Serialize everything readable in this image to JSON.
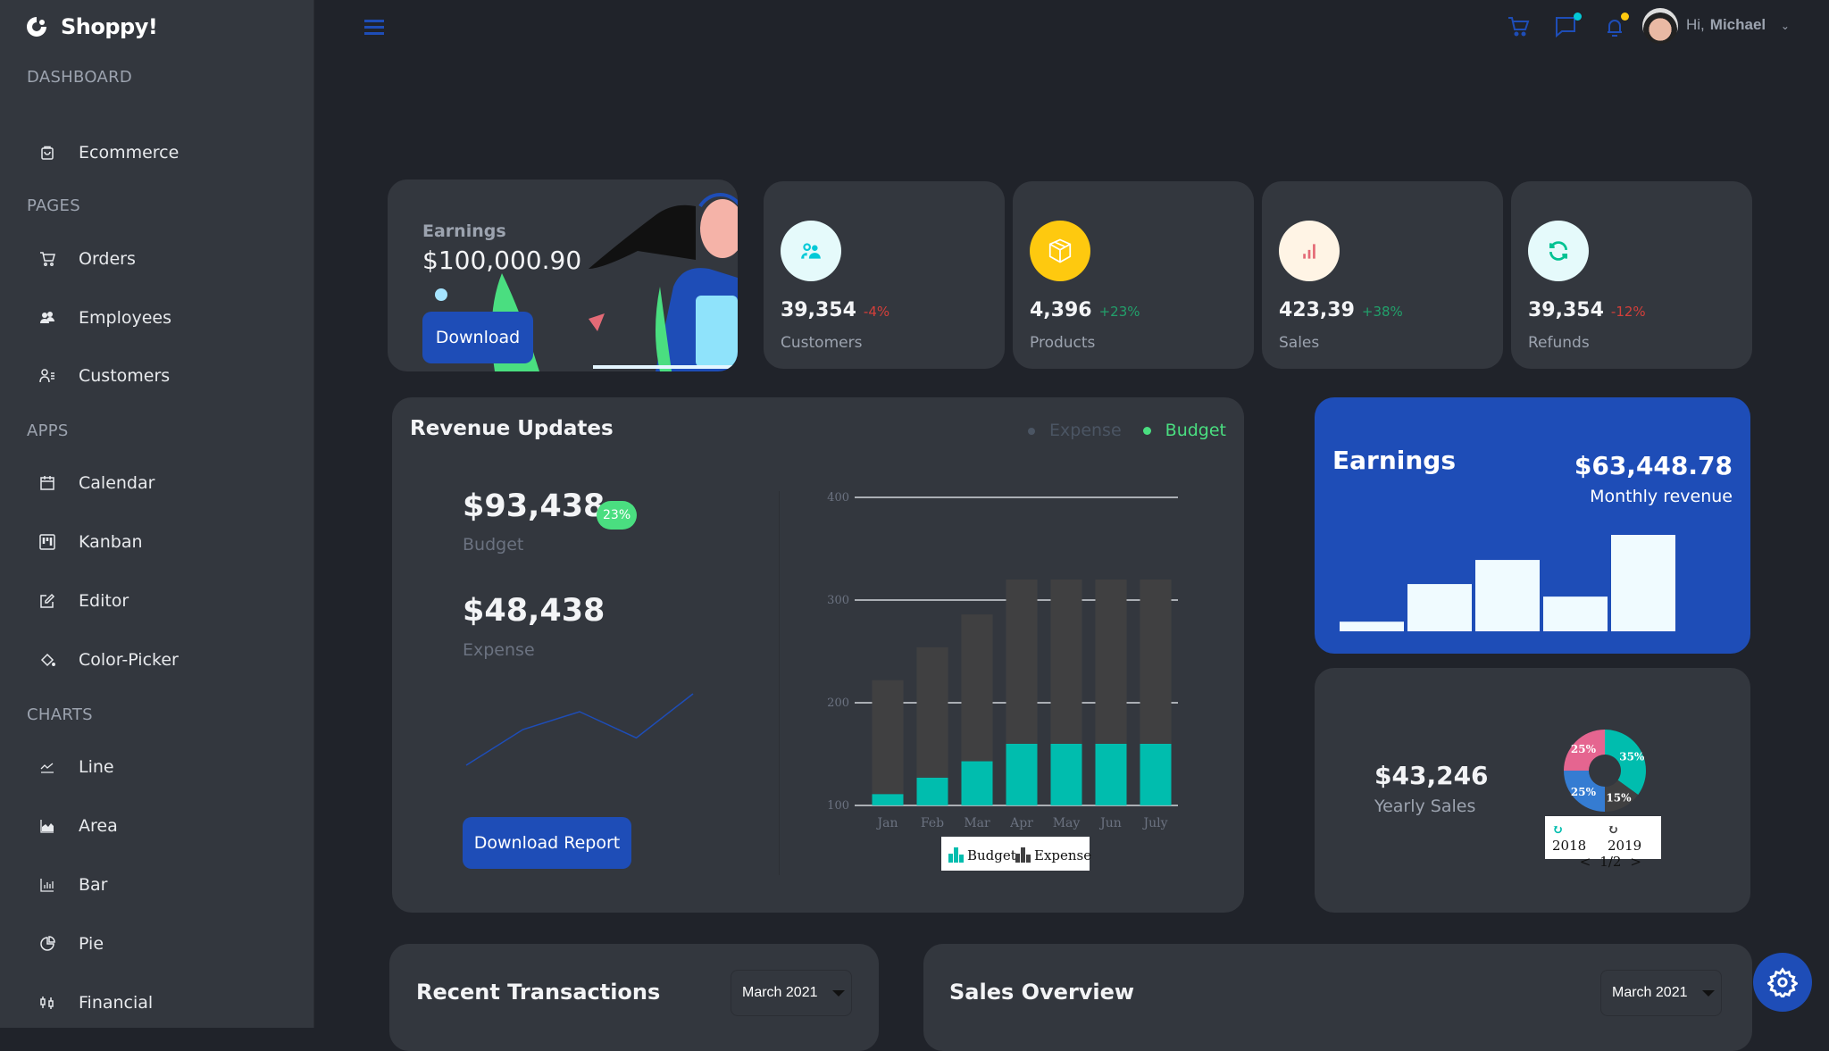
{
  "app": {
    "name": "Shoppy!"
  },
  "sidebar": {
    "sections": [
      {
        "title": "DASHBOARD",
        "items": [
          {
            "label": "Ecommerce",
            "icon": "shopping-bag-icon"
          }
        ]
      },
      {
        "title": "PAGES",
        "items": [
          {
            "label": "Orders",
            "icon": "cart-icon"
          },
          {
            "label": "Employees",
            "icon": "employees-icon"
          },
          {
            "label": "Customers",
            "icon": "customers-icon"
          }
        ]
      },
      {
        "title": "APPS",
        "items": [
          {
            "label": "Calendar",
            "icon": "calendar-icon"
          },
          {
            "label": "Kanban",
            "icon": "kanban-icon"
          },
          {
            "label": "Editor",
            "icon": "edit-icon"
          },
          {
            "label": "Color-Picker",
            "icon": "paint-bucket-icon"
          }
        ]
      },
      {
        "title": "CHARTS",
        "items": [
          {
            "label": "Line",
            "icon": "line-chart-icon"
          },
          {
            "label": "Area",
            "icon": "area-chart-icon"
          },
          {
            "label": "Bar",
            "icon": "bar-chart-icon"
          },
          {
            "label": "Pie",
            "icon": "pie-chart-icon"
          },
          {
            "label": "Financial",
            "icon": "candlestick-icon"
          }
        ]
      }
    ]
  },
  "header": {
    "greeting": "Hi,",
    "user_name": "Michael",
    "icons": [
      "menu-icon",
      "cart-icon",
      "chat-icon",
      "bell-icon",
      "avatar",
      "chevron-down-icon"
    ],
    "notification_colors": {
      "chat": "#03C9D7",
      "bell": "#FEC90F"
    }
  },
  "earnings_banner": {
    "title": "Earnings",
    "amount": "$100,000.90",
    "button": "Download"
  },
  "stats": [
    {
      "value": "39,354",
      "change": "-4%",
      "trend": "down",
      "label": "Customers",
      "icon": "customers-icon",
      "icon_color": "#03C9D7",
      "bg": "#E5FAFB"
    },
    {
      "value": "4,396",
      "change": "+23%",
      "trend": "up",
      "label": "Products",
      "icon": "box-icon",
      "icon_color": "#FFFFFF",
      "bg": "#FEC90F"
    },
    {
      "value": "423,39",
      "change": "+38%",
      "trend": "up",
      "label": "Sales",
      "icon": "bar-chart-icon",
      "icon_color": "#E46A76",
      "bg": "#FFF4E5"
    },
    {
      "value": "39,354",
      "change": "-12%",
      "trend": "down",
      "label": "Refunds",
      "icon": "refresh-icon",
      "icon_color": "#00C292",
      "bg": "#E5FAFB"
    }
  ],
  "revenue": {
    "title": "Revenue Updates",
    "legend": [
      {
        "label": "Expense",
        "color": "#4b5563"
      },
      {
        "label": "Budget",
        "color": "#4ade80"
      }
    ],
    "budget_value": "$93,438",
    "budget_badge": "23%",
    "budget_label": "Budget",
    "expense_value": "$48,438",
    "expense_label": "Expense",
    "button": "Download Report",
    "sparkline": [
      1,
      4,
      5.5,
      3.3,
      7
    ]
  },
  "earnings_card": {
    "title": "Earnings",
    "amount": "$63,448.78",
    "subtitle": "Monthly revenue",
    "bars": [
      10,
      49,
      74,
      36,
      100
    ]
  },
  "yearly": {
    "amount": "$43,246",
    "label": "Yearly Sales",
    "legend": [
      "2018",
      "2019"
    ],
    "pager": "1/2",
    "prev": "<",
    "next": ">"
  },
  "bottom": {
    "transactions_title": "Recent Transactions",
    "transactions_period": "March 2021",
    "sales_title": "Sales Overview",
    "sales_period": "March 2021"
  },
  "colors": {
    "accent": "#1E4DB7",
    "budget": "#00BDAE",
    "expense": "#404041",
    "up": "#22A06B",
    "down": "#D43F3A"
  },
  "chart_data": [
    {
      "type": "bar",
      "title": "Revenue Updates",
      "stacked": true,
      "categories": [
        "Jan",
        "Feb",
        "Mar",
        "Apr",
        "May",
        "Jun",
        "July"
      ],
      "series": [
        {
          "name": "Budget",
          "values": [
            111,
            127,
            143,
            160,
            160,
            160,
            160
          ]
        },
        {
          "name": "Expense",
          "values": [
            111,
            127,
            143,
            160,
            160,
            160,
            160
          ]
        }
      ],
      "ylim": [
        100,
        400
      ],
      "yticks": [
        100,
        200,
        300,
        400
      ],
      "legend": "bottom",
      "grid": true
    },
    {
      "type": "pie",
      "title": "Yearly Sales",
      "labels": [
        "35%",
        "15%",
        "25%",
        "25%"
      ],
      "values": [
        35,
        15,
        25,
        25
      ],
      "colors": [
        "#00BDAE",
        "#404041",
        "#357CD2",
        "#E56590"
      ],
      "donut": true
    }
  ]
}
